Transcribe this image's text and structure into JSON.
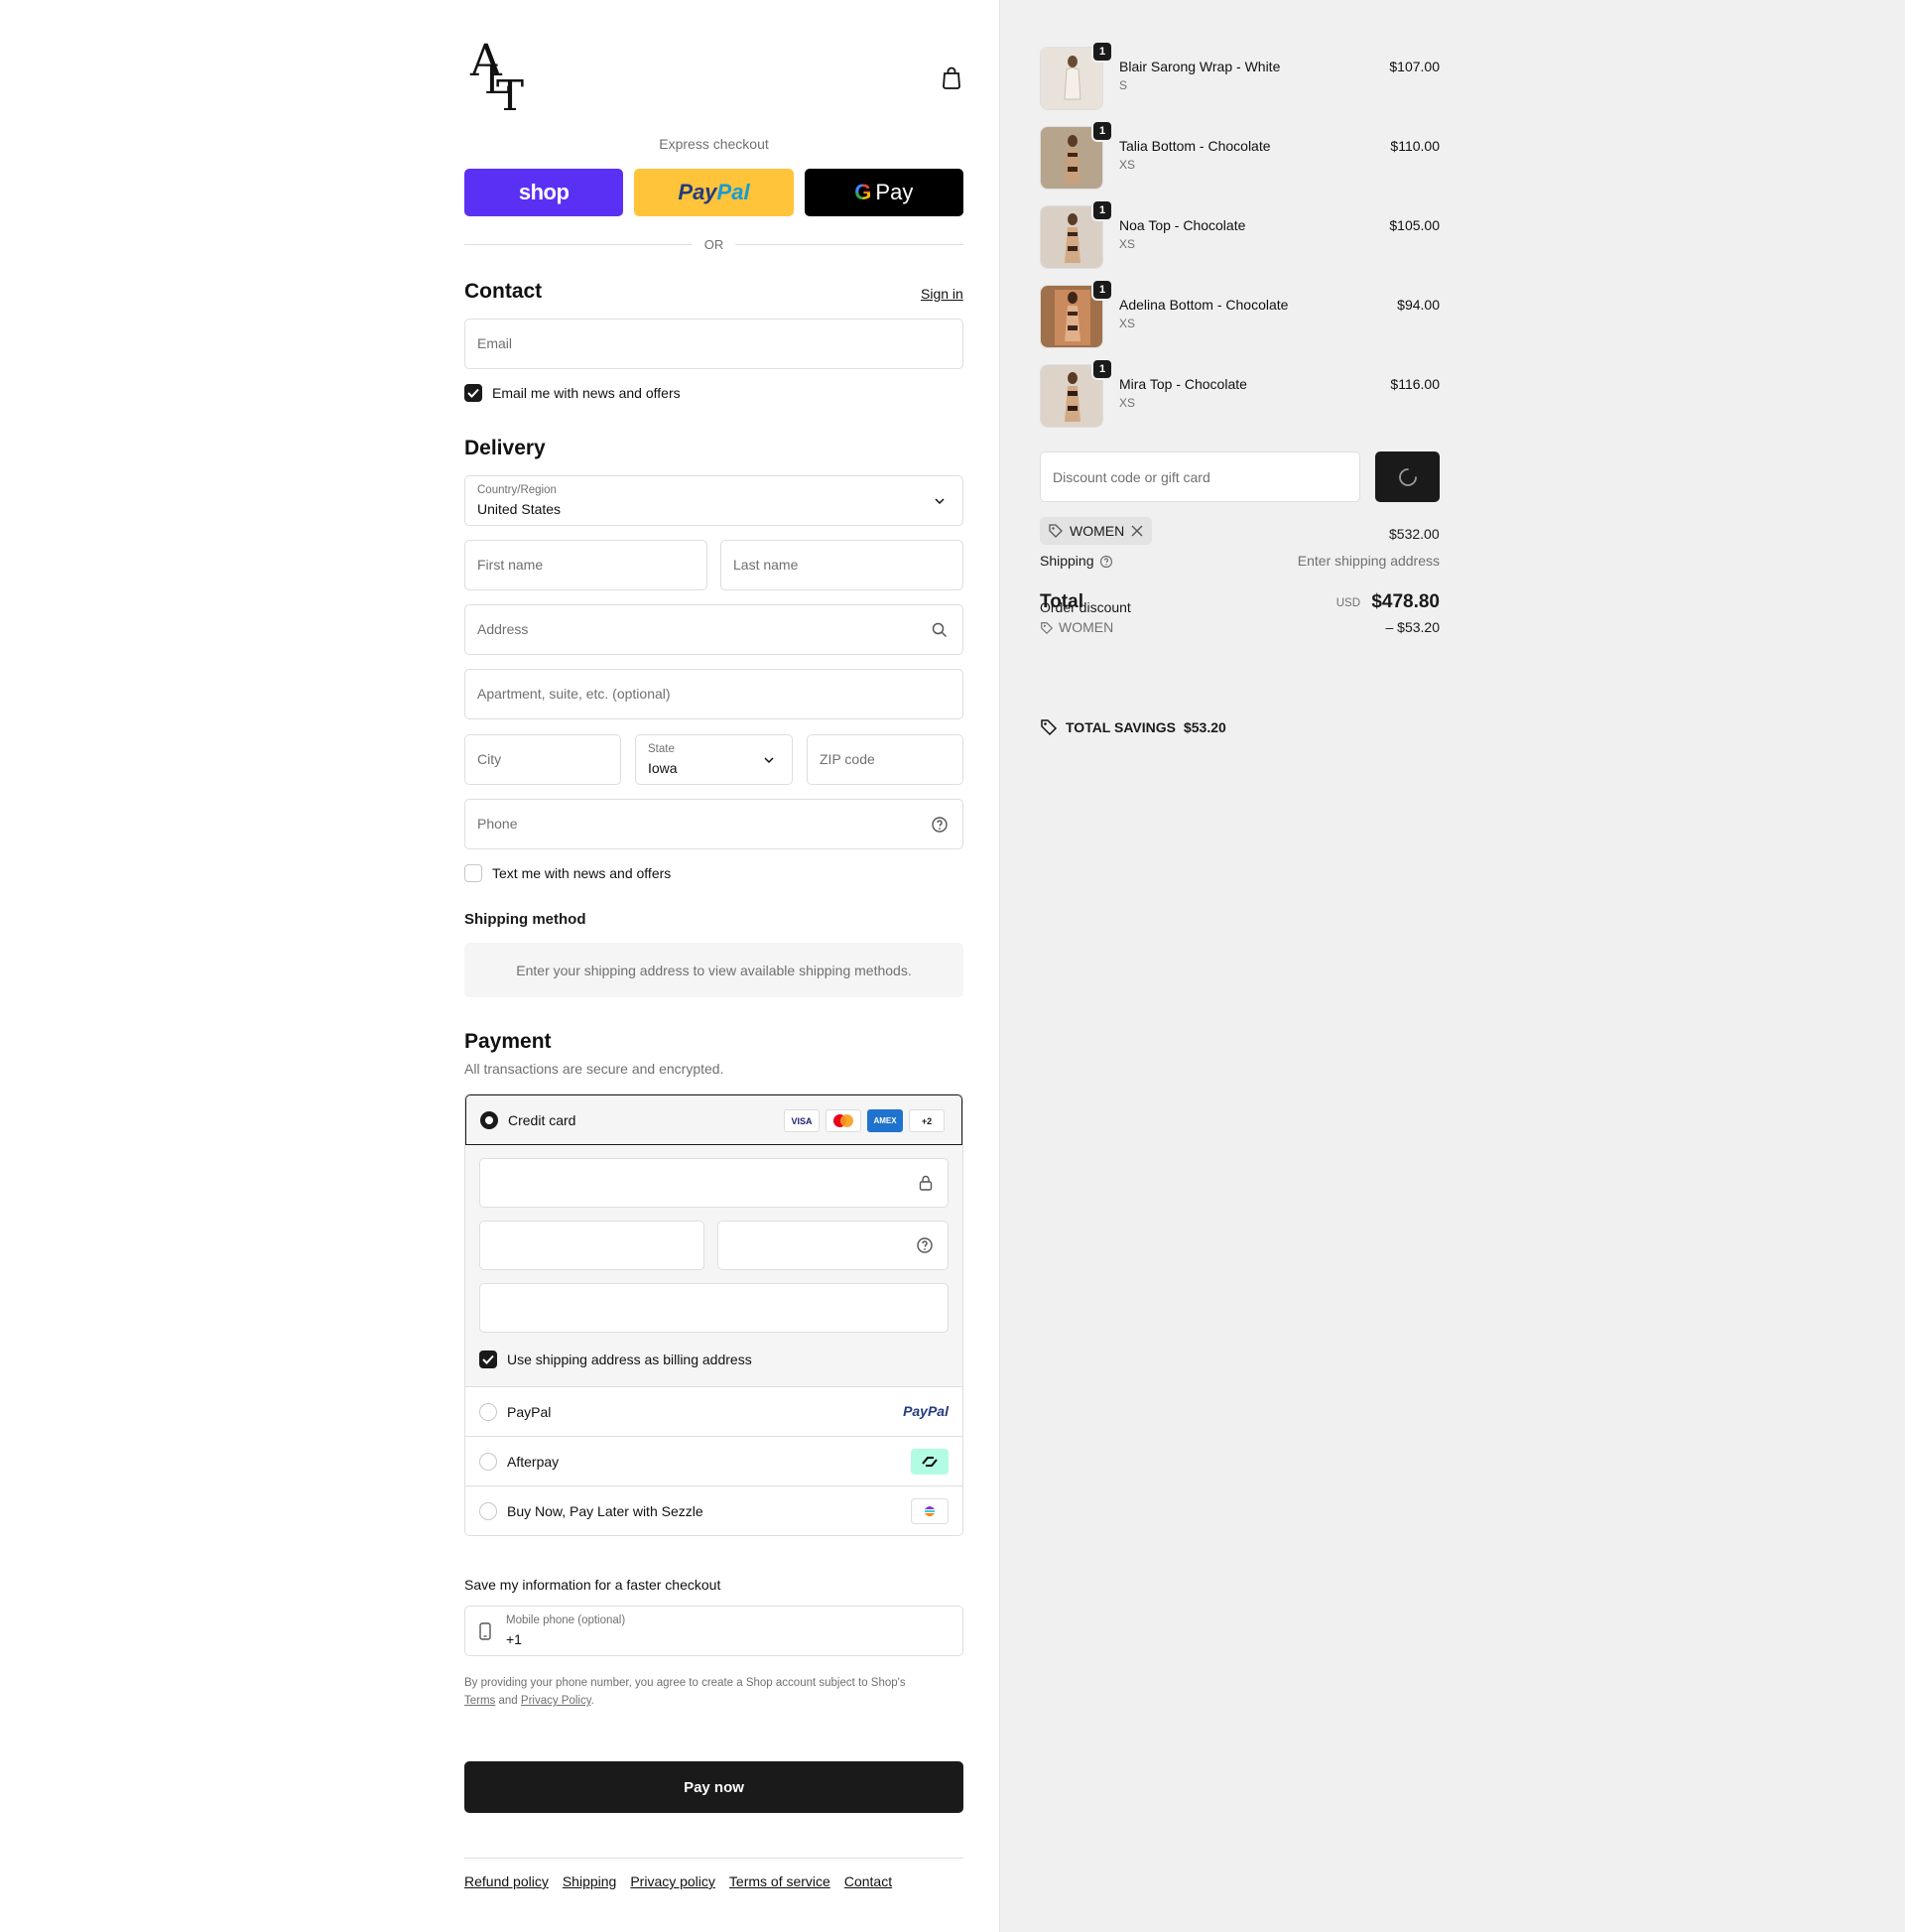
{
  "brand": {
    "logo_letters": [
      "A",
      "L",
      "T"
    ]
  },
  "express": {
    "title": "Express checkout",
    "shop_label": "shop",
    "paypal_part1": "Pay",
    "paypal_part2": "Pal",
    "gpay_g": "G",
    "gpay_label": "Pay",
    "or_label": "OR"
  },
  "contact": {
    "title": "Contact",
    "signin_label": "Sign in",
    "email_placeholder": "Email",
    "email_news_label": "Email me with news and offers",
    "email_news_checked": true
  },
  "delivery": {
    "title": "Delivery",
    "country_label": "Country/Region",
    "country_value": "United States",
    "first_name_placeholder": "First name",
    "last_name_placeholder": "Last name",
    "address_placeholder": "Address",
    "apartment_placeholder": "Apartment, suite, etc. (optional)",
    "city_placeholder": "City",
    "state_label": "State",
    "state_value": "Iowa",
    "zip_placeholder": "ZIP code",
    "phone_placeholder": "Phone",
    "text_news_label": "Text me with news and offers",
    "text_news_checked": false
  },
  "shipping_method": {
    "title": "Shipping method",
    "message": "Enter your shipping address to view available shipping methods."
  },
  "payment": {
    "title": "Payment",
    "subtitle": "All transactions are secure and encrypted.",
    "credit_card_label": "Credit card",
    "card_logos": [
      "VISA",
      "MC",
      "AMEX",
      "+2"
    ],
    "billing_same_label": "Use shipping address as billing address",
    "billing_same_checked": true,
    "paypal_label": "PayPal",
    "paypal_logo": "PayPal",
    "afterpay_label": "Afterpay",
    "sezzle_label": "Buy Now, Pay Later with Sezzle"
  },
  "save_info": {
    "title": "Save my information for a faster checkout",
    "mobile_label": "Mobile phone (optional)",
    "mobile_value": "+1",
    "legal_text": "By providing your phone number, you agree to create a Shop account subject to Shop's",
    "terms_link": "Terms",
    "and_text": "and",
    "privacy_link": "Privacy Policy",
    "period": "."
  },
  "pay_now_label": "Pay now",
  "footer_links": [
    "Refund policy",
    "Shipping",
    "Privacy policy",
    "Terms of service",
    "Contact"
  ],
  "cart": {
    "items": [
      {
        "name": "Blair Sarong Wrap - White",
        "variant": "S",
        "price": "$107.00",
        "qty": "1",
        "tone": "#e8e2da"
      },
      {
        "name": "Talia Bottom - Chocolate",
        "variant": "XS",
        "price": "$110.00",
        "qty": "1",
        "tone": "#b7a48c"
      },
      {
        "name": "Noa Top - Chocolate",
        "variant": "XS",
        "price": "$105.00",
        "qty": "1",
        "tone": "#d9cfc4"
      },
      {
        "name": "Adelina Bottom - Chocolate",
        "variant": "XS",
        "price": "$94.00",
        "qty": "1",
        "tone": "#a0704a"
      },
      {
        "name": "Mira Top - Chocolate",
        "variant": "XS",
        "price": "$116.00",
        "qty": "1",
        "tone": "#ddd3c8"
      }
    ],
    "discount_placeholder": "Discount code or gift card",
    "applied_code": "WOMEN",
    "subtotal": "$532.00",
    "shipping_label": "Shipping",
    "shipping_value": "Enter shipping address",
    "total_label": "Total",
    "order_discount_label": "Order discount",
    "currency": "USD",
    "total_value": "$478.80",
    "discount_code_line": "WOMEN",
    "discount_amount": "– $53.20",
    "savings_label": "TOTAL SAVINGS",
    "savings_value": "$53.20"
  }
}
